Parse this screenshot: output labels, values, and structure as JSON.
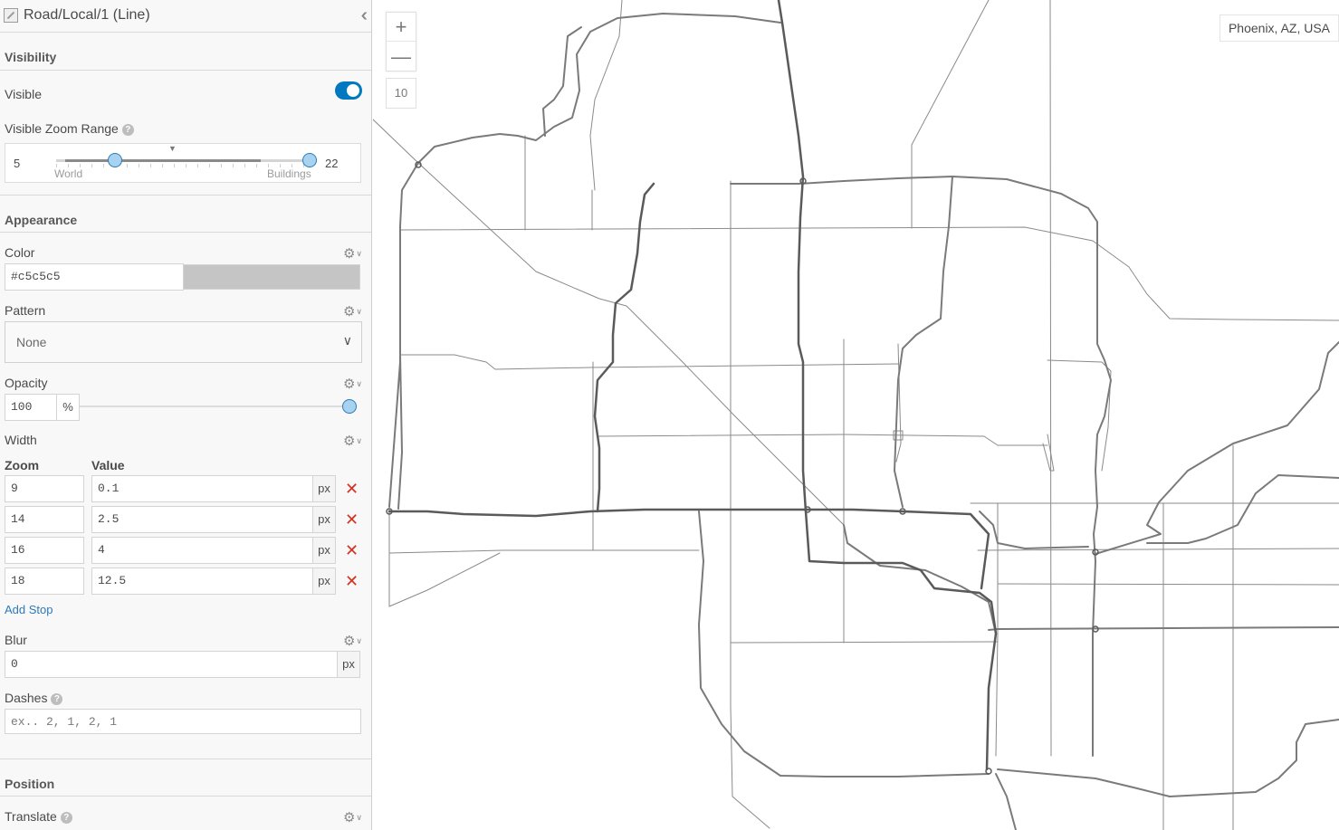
{
  "header": {
    "title": "Road/Local/1 (Line)",
    "collapse_icon": "double-chevron-left-icon"
  },
  "sections": {
    "visibility": "Visibility",
    "appearance": "Appearance",
    "position": "Position"
  },
  "visibility": {
    "visible_label": "Visible",
    "visible_on": true,
    "zoom_range_label": "Visible Zoom Range",
    "zoom_min": "5",
    "zoom_max": "22",
    "min_label": "World",
    "max_label": "Buildings"
  },
  "appearance": {
    "color_label": "Color",
    "color_value": "#c5c5c5",
    "pattern_label": "Pattern",
    "pattern_value": "None",
    "opacity_label": "Opacity",
    "opacity_value": "100",
    "opacity_unit": "%",
    "width_label": "Width",
    "zoom_col": "Zoom",
    "value_col": "Value",
    "unit": "px",
    "stops": [
      {
        "zoom": "9",
        "value": "0.1"
      },
      {
        "zoom": "14",
        "value": "2.5"
      },
      {
        "zoom": "16",
        "value": "4"
      },
      {
        "zoom": "18",
        "value": "12.5"
      }
    ],
    "add_stop": "Add Stop",
    "blur_label": "Blur",
    "blur_value": "0",
    "dashes_label": "Dashes",
    "dashes_placeholder": "ex.. 2, 1, 2, 1"
  },
  "position": {
    "translate_label": "Translate"
  },
  "map": {
    "zoom_in": "+",
    "zoom_out": "—",
    "zoom_level": "10",
    "location": "Phoenix, AZ, USA",
    "road_color": "#7a7a7a",
    "major_road_color": "#5a5a5a"
  },
  "colors": {
    "accent": "#0079c1",
    "delete": "#d83020",
    "link": "#2e79b9"
  }
}
